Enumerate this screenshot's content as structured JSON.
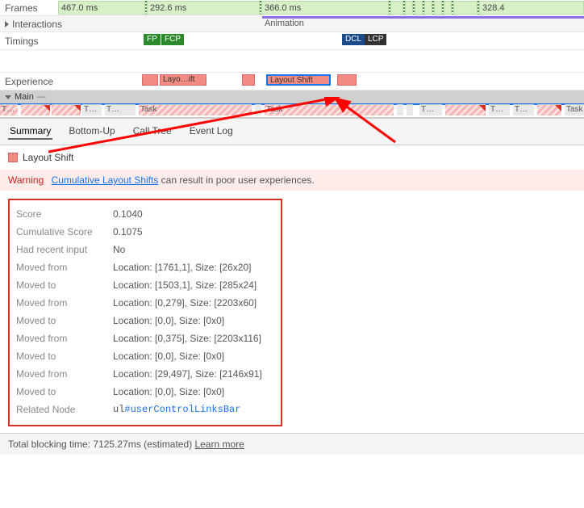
{
  "timeline": {
    "rows": {
      "frames": "Frames",
      "interactions": "Interactions",
      "timings": "Timings",
      "experience": "Experience",
      "main": "Main"
    },
    "frame_times": [
      "467.0 ms",
      "292.6 ms",
      "366.0 ms",
      "328.4"
    ],
    "animation_label": "Animation",
    "timing_badges": {
      "fp": "FP",
      "fcp": "FCP",
      "dcl": "DCL",
      "lcp": "LCP"
    },
    "experience": {
      "trunc": "Layo…ift",
      "full": "Layout Shift"
    },
    "tasks": [
      "T…",
      "T…",
      "T…",
      "Task",
      "Task",
      "T…",
      "T…",
      "T…",
      "Task"
    ],
    "main_dash": "—"
  },
  "tabs": {
    "summary": "Summary",
    "bottomup": "Bottom-Up",
    "calltree": "Call Tree",
    "eventlog": "Event Log"
  },
  "summary": {
    "title": "Layout Shift",
    "warning_label": "Warning",
    "warning_link": "Cumulative Layout Shifts",
    "warning_rest": " can result in poor user experiences.",
    "details": [
      {
        "label": "Score",
        "value": "0.1040"
      },
      {
        "label": "Cumulative Score",
        "value": "0.1075"
      },
      {
        "label": "Had recent input",
        "value": "No"
      },
      {
        "label": "Moved from",
        "value": "Location: [1761,1], Size: [26x20]"
      },
      {
        "label": "Moved to",
        "value": "Location: [1503,1], Size: [285x24]"
      },
      {
        "label": "Moved from",
        "value": "Location: [0,279], Size: [2203x60]"
      },
      {
        "label": "Moved to",
        "value": "Location: [0,0], Size: [0x0]"
      },
      {
        "label": "Moved from",
        "value": "Location: [0,375], Size: [2203x116]"
      },
      {
        "label": "Moved to",
        "value": "Location: [0,0], Size: [0x0]"
      },
      {
        "label": "Moved from",
        "value": "Location: [29,497], Size: [2146x91]"
      },
      {
        "label": "Moved to",
        "value": "Location: [0,0], Size: [0x0]"
      }
    ],
    "related_label": "Related Node",
    "related_tag": "ul",
    "related_id": "#userControlLinksBar"
  },
  "footer": {
    "prefix": "Total blocking time: ",
    "time": "7125.27ms",
    "suffix": " (estimated) ",
    "link": "Learn more"
  }
}
